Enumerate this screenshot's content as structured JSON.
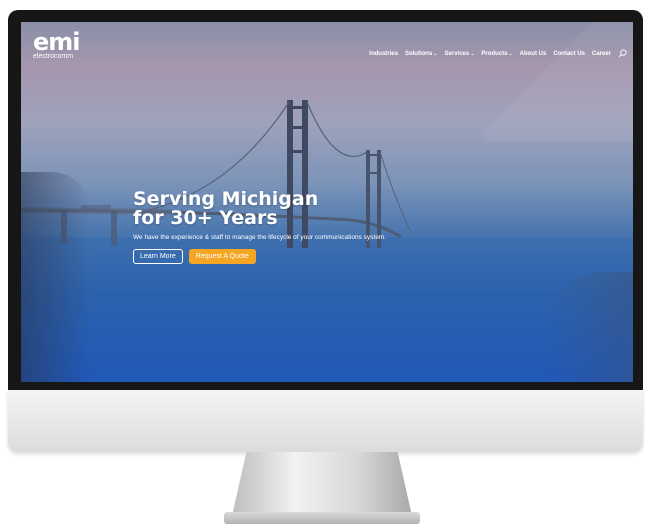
{
  "site": {
    "logo_mark": "emi",
    "logo_sub": "electrocomm"
  },
  "nav": {
    "items": [
      {
        "label": "Industries",
        "dropdown": false
      },
      {
        "label": "Solutions",
        "dropdown": true
      },
      {
        "label": "Services",
        "dropdown": true
      },
      {
        "label": "Products",
        "dropdown": true
      },
      {
        "label": "About Us",
        "dropdown": false
      },
      {
        "label": "Contact Us",
        "dropdown": false
      },
      {
        "label": "Career",
        "dropdown": false
      }
    ],
    "search_icon": "search-icon"
  },
  "hero": {
    "title_line1": "Serving Michigan",
    "title_line2": "for 30+ Years",
    "subtitle": "We have the experience & staff to manage the lifecycle of your communications system.",
    "learn_more": "Learn More",
    "request_quote": "Request A Quote"
  },
  "colors": {
    "accent_orange": "#f5a623",
    "text": "#ffffff"
  }
}
